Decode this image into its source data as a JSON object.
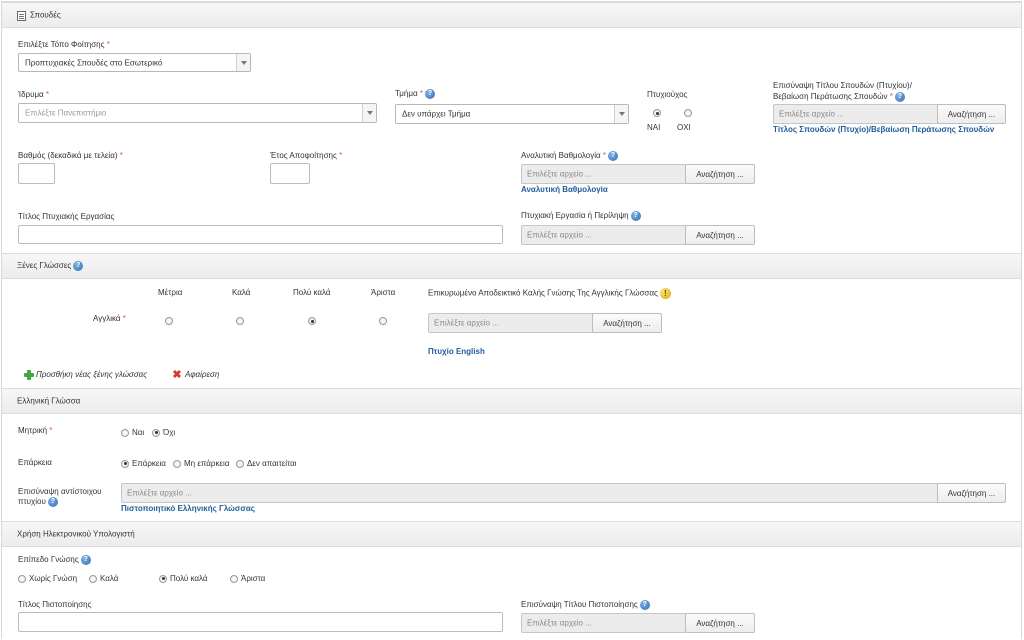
{
  "studies": {
    "title": "Σπουδές",
    "place_label": "Επιλέξτε Τόπο Φοίτησης",
    "place_value": "Προπτυχιακές Σπουδές στο Εσωτερικό",
    "institution_label": "Ίδρυμα",
    "institution_placeholder": "Επιλέξτε Πανεπιστήμιο",
    "department_label": "Τμήμα",
    "department_value": "Δεν υπάρχει Τμήμα",
    "graduate_label": "Πτυχιούχος",
    "graduate_yes": "ΝΑΙ",
    "graduate_no": "ΟΧΙ",
    "degree_upload_label_1": "Επισύναψη Τίτλου Σπουδών (Πτυχίου)/",
    "degree_upload_label_2": "Βεβαίωση Περάτωσης Σπουδών",
    "degree_link": "Τίτλος Σπουδών (Πτυχίο)/Βεβαίωση Περάτωσης Σπουδών",
    "grade_label": "Βαθμός (δεκαδικά με τελεία)",
    "year_label": "Έτος Αποφοίτησης",
    "transcript_label": "Αναλυτική Βαθμολογία",
    "transcript_link": "Αναλυτική Βαθμολογία",
    "thesis_title_label": "Τίτλος Πτυχιακής Εργασίας",
    "thesis_upload_label": "Πτυχιακή Εργασία ή Περίληψη"
  },
  "file_placeholder": "Επιλέξτε αρχείο ...",
  "search_button": "Αναζήτηση ...",
  "languages": {
    "title": "Ξένες Γλώσσες",
    "levels": [
      "Μέτρια",
      "Καλά",
      "Πολύ καλά",
      "Άριστα"
    ],
    "cert_label": "Επικυρωμένο Αποδεικτικό Καλής Γνώσης Της Αγγλικής Γλώσσας",
    "language": "Αγγλικά",
    "selected_level": "Πολύ καλά",
    "cert_link": "Πτυχίο English",
    "add_label": "Προσθήκη νέας ξένης γλώσσας",
    "remove_label": "Αφαίρεση"
  },
  "greek": {
    "title": "Ελληνική Γλώσσα",
    "native_label": "Μητρική",
    "native_options": [
      "Ναι",
      "Όχι"
    ],
    "native_selected": "Όχι",
    "proficiency_label": "Επάρκεια",
    "proficiency_options": [
      "Επάρκεια",
      "Μη επάρκεια",
      "Δεν απαιτείται"
    ],
    "proficiency_selected": "Επάρκεια",
    "upload_label_1": "Επισύναψη αντίστοιχου",
    "upload_label_2": "πτυχίου",
    "cert_link": "Πιστοποιητικό Ελληνικής Γλώσσας"
  },
  "computer": {
    "title": "Χρήση Ηλεκτρονικού Υπολογιστή",
    "level_label": "Επίπεδο Γνώσης",
    "level_options": [
      "Χωρίς Γνώση",
      "Καλά",
      "Πολύ καλά",
      "Άριστα"
    ],
    "level_selected": "Πολύ καλά",
    "cert_title_label": "Τίτλος Πιστοποίησης",
    "cert_upload_label": "Επισύναψη Τίτλου Πιστοποίησης"
  }
}
